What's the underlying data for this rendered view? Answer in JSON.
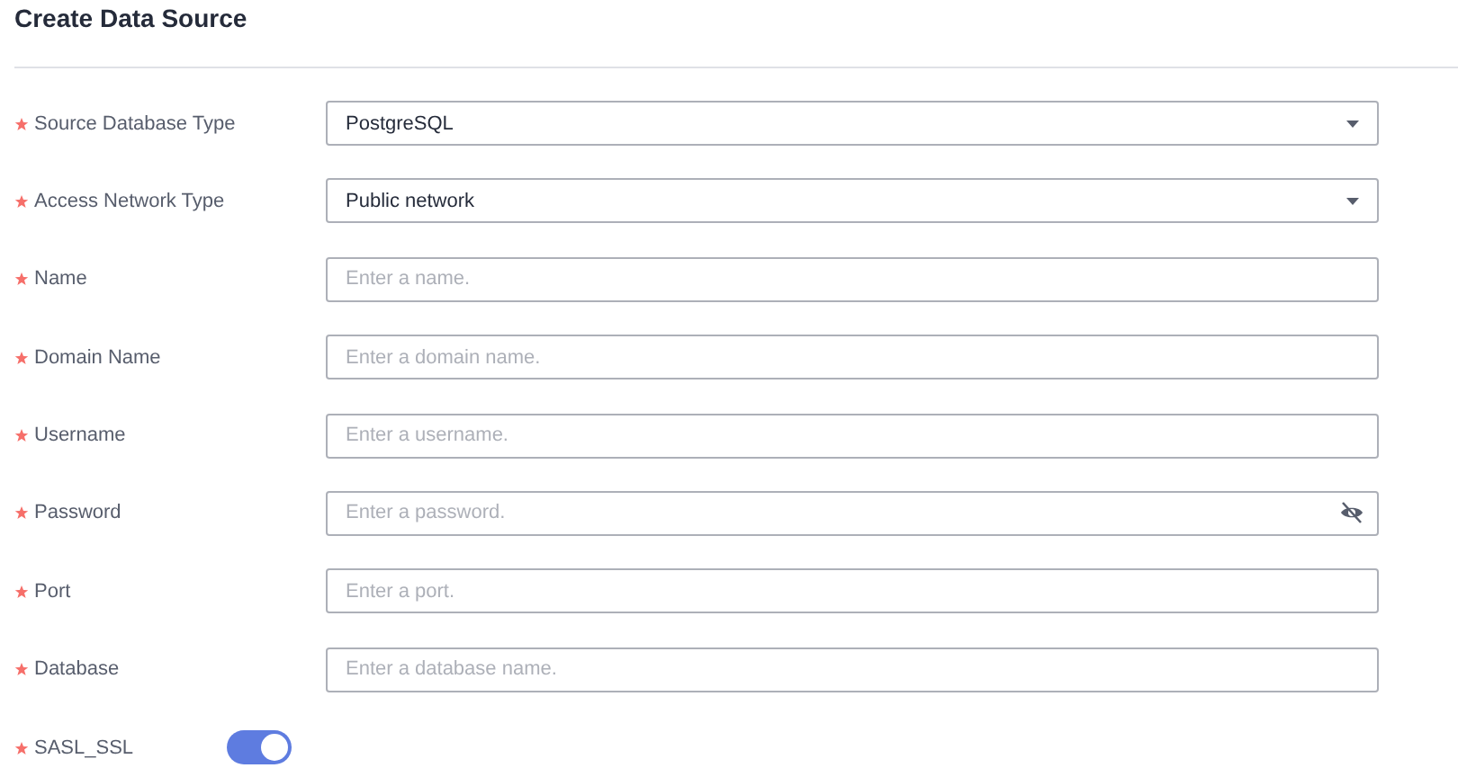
{
  "title": "Create Data Source",
  "fields": [
    {
      "kind": "select",
      "label": "Source Database Type",
      "required": true,
      "value": "PostgreSQL"
    },
    {
      "kind": "select",
      "label": "Access Network Type",
      "required": true,
      "value": "Public network"
    },
    {
      "kind": "input",
      "label": "Name",
      "required": true,
      "placeholder": "Enter a name."
    },
    {
      "kind": "input",
      "label": "Domain Name",
      "required": true,
      "placeholder": "Enter a domain name."
    },
    {
      "kind": "input",
      "label": "Username",
      "required": true,
      "placeholder": "Enter a username."
    },
    {
      "kind": "password",
      "label": "Password",
      "required": true,
      "placeholder": "Enter a password."
    },
    {
      "kind": "input",
      "label": "Port",
      "required": true,
      "placeholder": "Enter a port."
    },
    {
      "kind": "input",
      "label": "Database",
      "required": true,
      "placeholder": "Enter a database name."
    },
    {
      "kind": "switch",
      "label": "SASL_SSL",
      "required": true,
      "on": true
    }
  ]
}
